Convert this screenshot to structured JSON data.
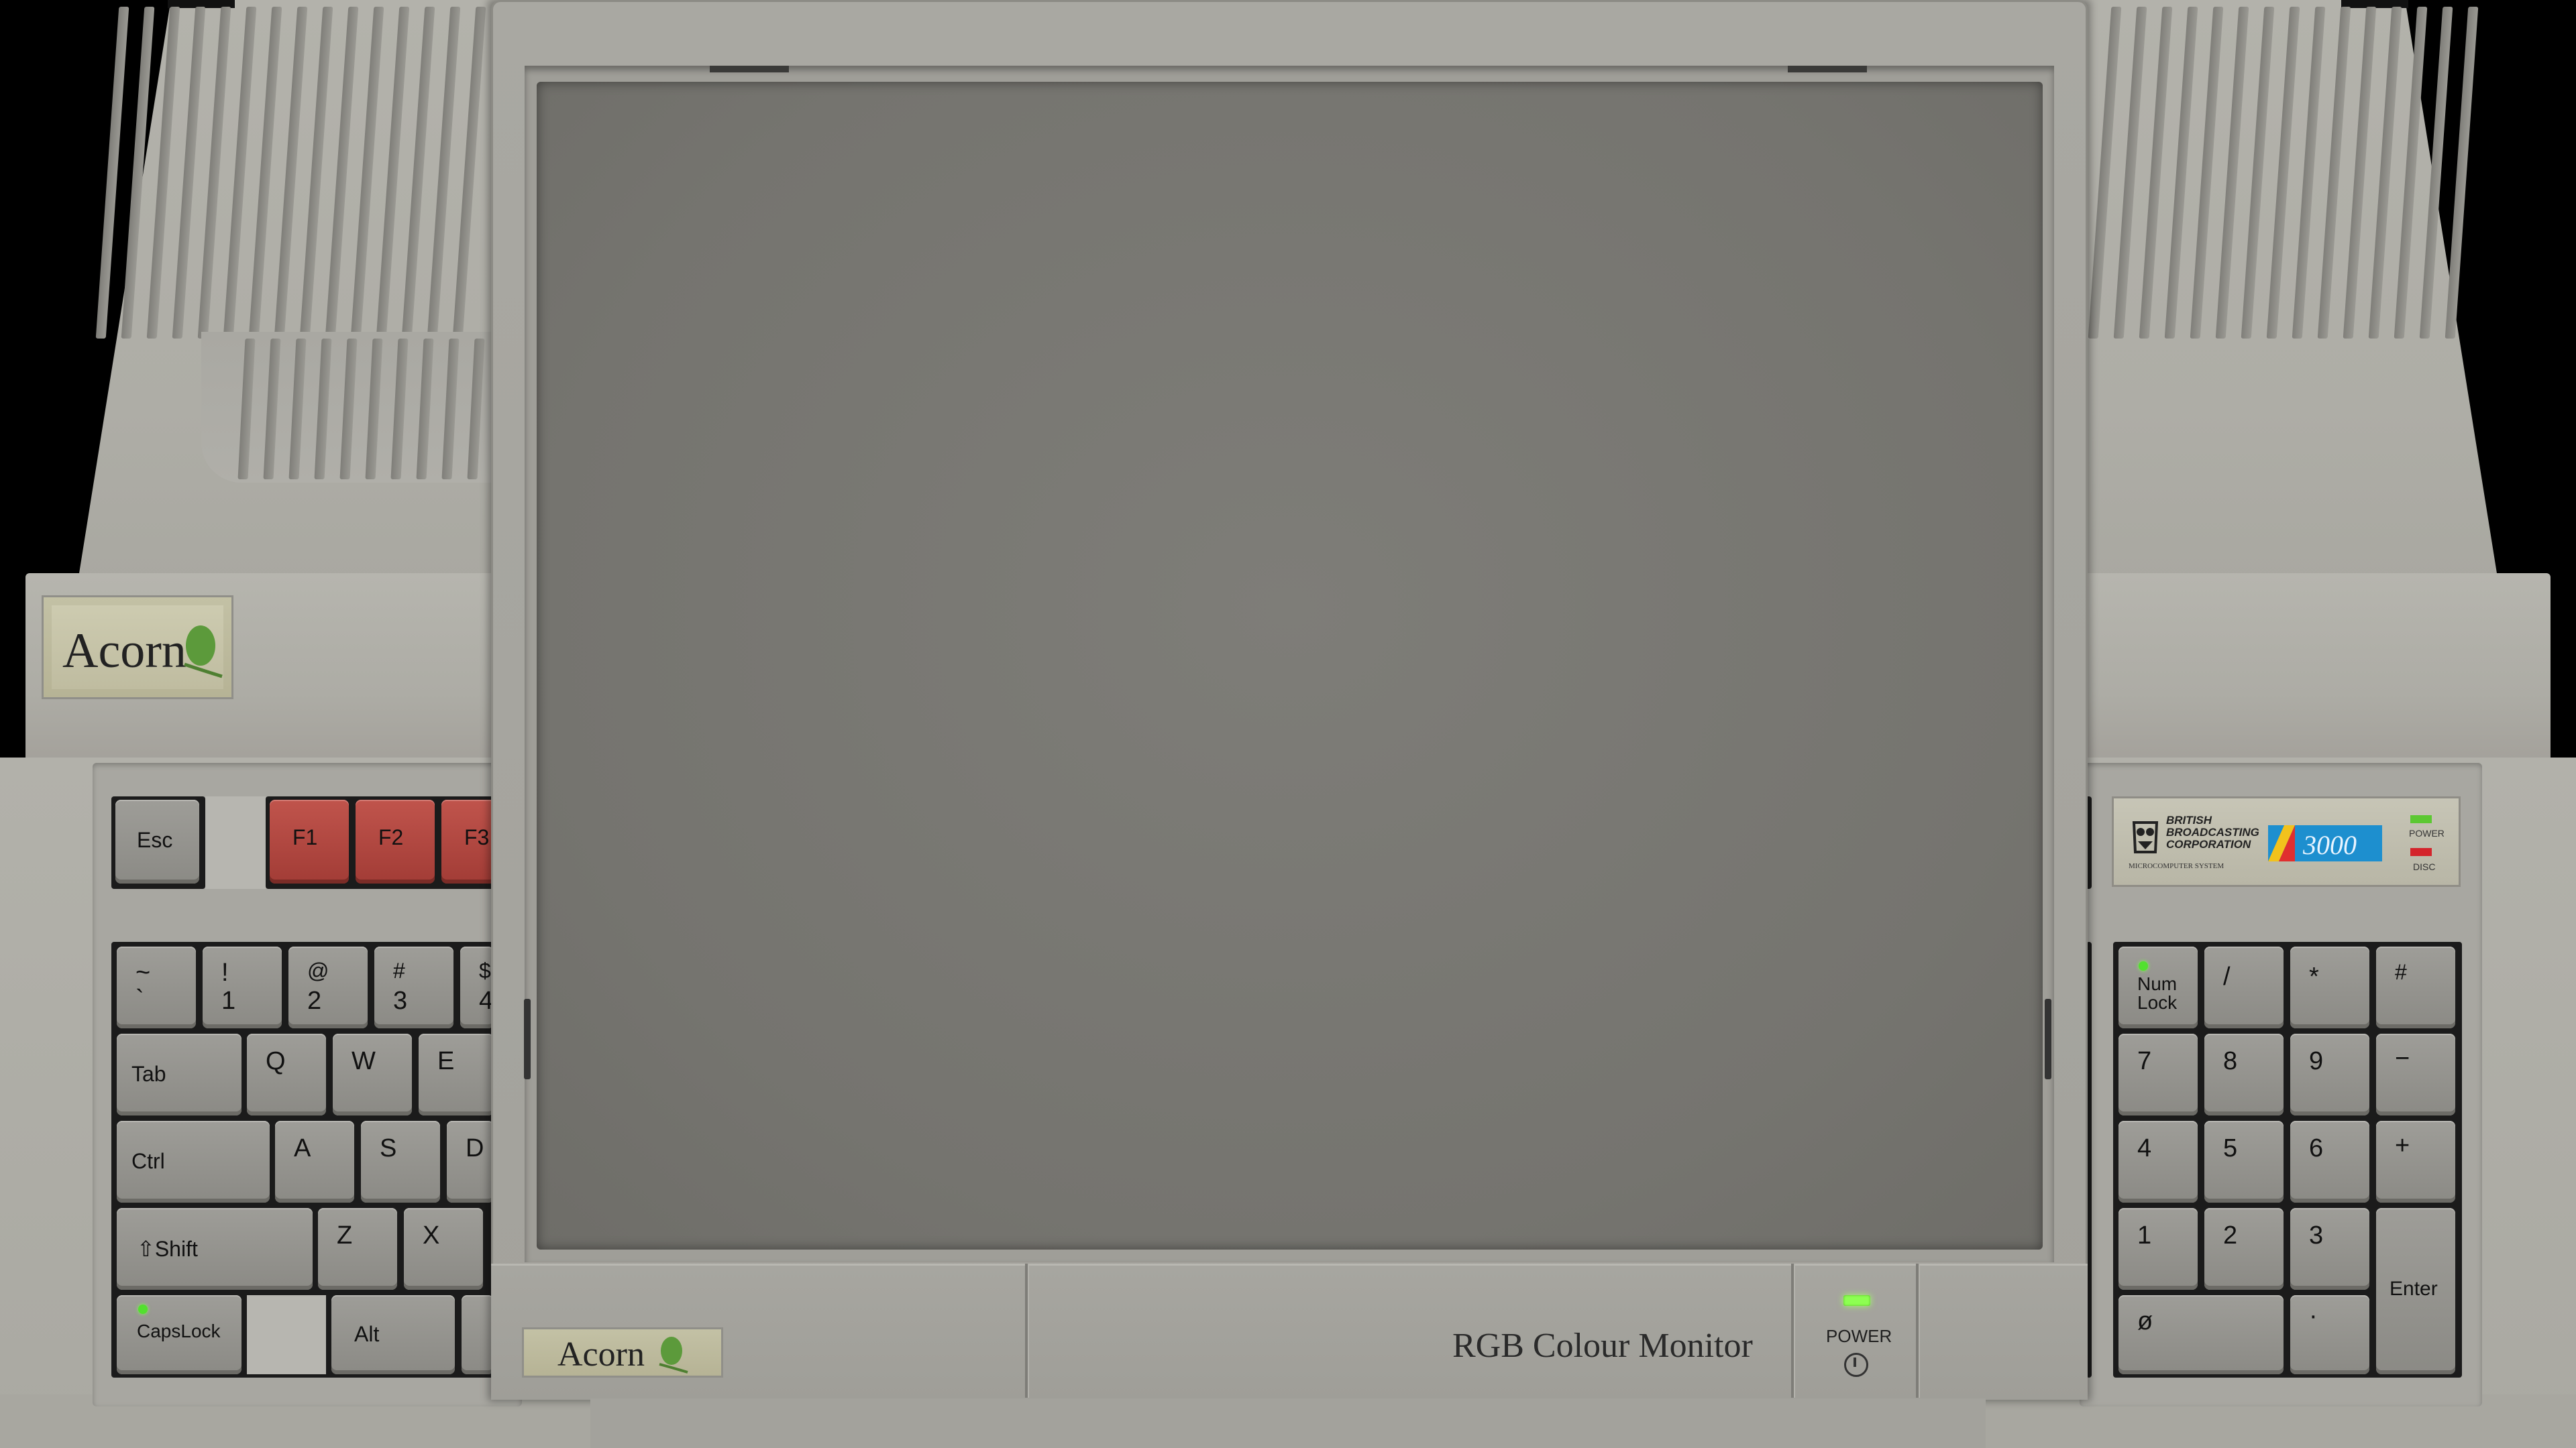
{
  "branding": {
    "case_badge": "Acorn",
    "monitor_badge": "Acorn",
    "monitor_label": "RGB Colour Monitor",
    "bbc_plate": {
      "line1": "BRITISH",
      "line2": "BROADCASTING",
      "line3": "CORPORATION",
      "line4": "MICROCOMPUTER SYSTEM",
      "model": "3000",
      "power_led_label": "POWER",
      "disc_led_label": "DISC"
    }
  },
  "monitor": {
    "power_label": "POWER",
    "power_symbol": "ⓘ"
  },
  "keyboard": {
    "esc": "Esc",
    "f1": "F1",
    "f2": "F2",
    "f3": "F3",
    "backtick_top": "~",
    "backtick_bottom": "`",
    "k1_top": "!",
    "k1_bottom": "1",
    "k2_top": "@",
    "k2_bottom": "2",
    "k3_top": "#",
    "k3_bottom": "3",
    "k4_top": "$",
    "k4_bottom": "4",
    "tab": "Tab",
    "q": "Q",
    "w": "W",
    "e": "E",
    "ctrl": "Ctrl",
    "a": "A",
    "s": "S",
    "d": "D",
    "shift": "⇧Shift",
    "z": "Z",
    "x": "X",
    "capslock": "CapsLock",
    "alt": "Alt"
  },
  "keypad": {
    "numlock": "Num\nLock",
    "slash": "/",
    "star": "*",
    "hash": "#",
    "k7": "7",
    "k8": "8",
    "k9": "9",
    "minus": "−",
    "k4": "4",
    "k5": "5",
    "k6": "6",
    "plus": "+",
    "k1": "1",
    "k2": "2",
    "k3": "3",
    "enter": "Enter",
    "k0": "ø",
    "dot": "·"
  },
  "colors": {
    "case": "#adaca5",
    "screen": "#777671",
    "function_keys": "#b14740",
    "led_green": "#52e02e",
    "disc_led": "#d4242b",
    "model_badge": "#1d8fcf"
  }
}
